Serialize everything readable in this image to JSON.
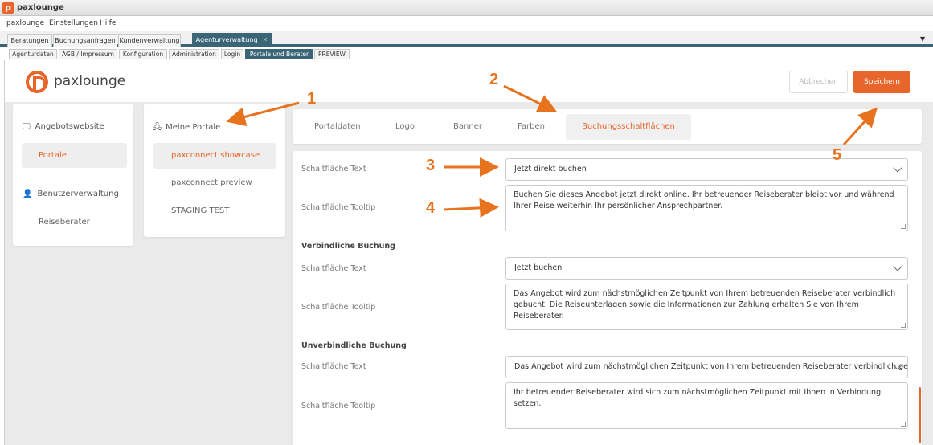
{
  "window": {
    "title": "paxlounge",
    "icon_letter": "p"
  },
  "menu": [
    "paxlounge",
    "Einstellungen",
    "Hilfe"
  ],
  "main_tabs": [
    "Beratungen",
    "Buchungsanfragen",
    "Kundenverwaltung",
    "Agenturverwaltung"
  ],
  "sub_tabs": [
    "Agenturdaten",
    "AGB / Impressum",
    "Konfiguration",
    "Administration",
    "Login",
    "Portale und Berater",
    "PREVIEW"
  ],
  "header": {
    "logo_text": "paxlounge",
    "cancel_label": "Abbrechen",
    "save_label": "Speichern"
  },
  "colors": {
    "accent": "#e8652b",
    "tab_active": "#3a6577",
    "annotation": "#e8731f"
  },
  "sidebar": {
    "website_label": "Angebotswebsite",
    "website_icon": "monitor-icon",
    "portale_label": "Portale",
    "users_label": "Benutzerverwaltung",
    "users_icon": "user-icon",
    "advisors_label": "Reiseberater"
  },
  "portals": {
    "heading": "Meine Portale",
    "heading_icon": "sitemap-icon",
    "items": [
      "paxconnect showcase",
      "paxconnect preview",
      "STAGING TEST"
    ]
  },
  "portal_tabs": [
    "Portaldaten",
    "Logo",
    "Banner",
    "Farben",
    "Buchungsschaltflächen"
  ],
  "form": {
    "text_label": "Schaltfläche Text",
    "tooltip_label": "Schaltfläche Tooltip",
    "section1": {
      "text": "Jetzt direkt buchen",
      "tooltip": "Buchen Sie dieses Angebot jetzt direkt online. Ihr betreuender Reiseberater bleibt vor und während Ihrer Reise weiterhin Ihr persönlicher Ansprechpartner."
    },
    "section2": {
      "heading": "Verbindliche Buchung",
      "text": "Jetzt buchen",
      "tooltip": "Das Angebot wird zum nächstmöglichen Zeitpunkt von Ihrem betreuenden Reiseberater verbindlich gebucht. Die Reiseunterlagen sowie die Informationen zur Zahlung erhalten Sie von Ihrem Reiseberater."
    },
    "section3": {
      "heading": "Unverbindliche Buchung",
      "text": "Das Angebot wird zum nächstmöglichen Zeitpunkt von Ihrem betreuenden Reiseberater verbindlich gebucht.",
      "tooltip": "Ihr betreuender Reiseberater wird sich zum nächstmöglichen Zeitpunkt mit Ihnen in Verbindung setzen."
    }
  },
  "annotations": [
    "1",
    "2",
    "3",
    "4",
    "5"
  ]
}
